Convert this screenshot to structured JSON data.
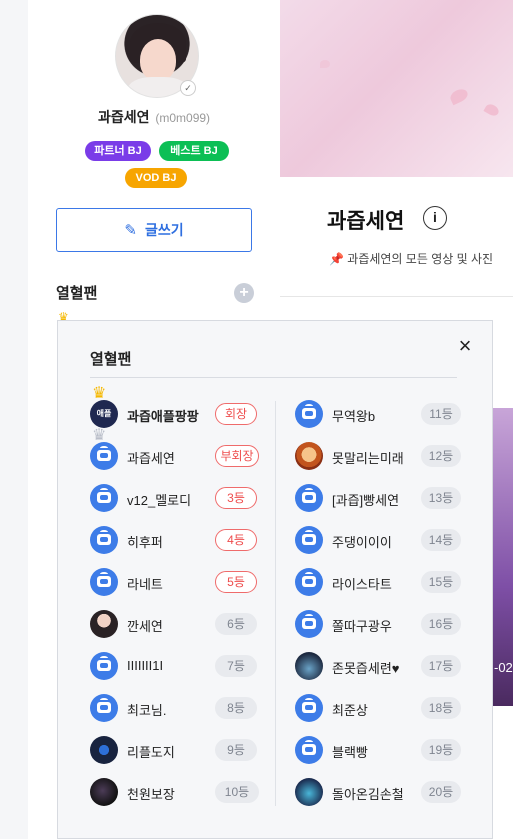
{
  "profile": {
    "name": "과즙세연",
    "uid": "(m0m099)",
    "badges": [
      "파트너 BJ",
      "베스트 BJ",
      "VOD BJ"
    ],
    "write_label": "글쓰기",
    "fan_heading": "열혈팬",
    "fan_plus": "+"
  },
  "main": {
    "title": "과즙세연",
    "desc": "📌 과즙세연의 모든 영상 및 사진",
    "thumb_text": "-02"
  },
  "popup": {
    "title": "열혈팬",
    "close": "×",
    "left": [
      {
        "name": "과즙애플팡팡",
        "rank": "회장",
        "style": "red",
        "avatar": "apple",
        "crown": "gold",
        "bold": true
      },
      {
        "name": "과즙세연",
        "rank": "부회장",
        "style": "red",
        "avatar": "tv",
        "crown": "silver",
        "bold": false
      },
      {
        "name": "v12_멜로디",
        "rank": "3등",
        "style": "red",
        "avatar": "tv",
        "crown": "",
        "bold": false
      },
      {
        "name": "히후퍼",
        "rank": "4등",
        "style": "red",
        "avatar": "tv",
        "crown": "",
        "bold": false
      },
      {
        "name": "라네트",
        "rank": "5등",
        "style": "red",
        "avatar": "tv",
        "crown": "",
        "bold": false
      },
      {
        "name": "깐세연",
        "rank": "6등",
        "style": "gray",
        "avatar": "photo1",
        "crown": "",
        "bold": false
      },
      {
        "name": "IIIIIII1I",
        "rank": "7등",
        "style": "gray",
        "avatar": "tv",
        "crown": "",
        "bold": false
      },
      {
        "name": "최코님.",
        "rank": "8등",
        "style": "gray",
        "avatar": "tv",
        "crown": "",
        "bold": false
      },
      {
        "name": "리플도지",
        "rank": "9등",
        "style": "gray",
        "avatar": "tech",
        "crown": "",
        "bold": false
      },
      {
        "name": "천원보장",
        "rank": "10등",
        "style": "gray",
        "avatar": "dark1",
        "crown": "",
        "bold": false
      }
    ],
    "right": [
      {
        "name": "무역왕b",
        "rank": "11등",
        "style": "gray",
        "avatar": "tv"
      },
      {
        "name": "못말리는미래",
        "rank": "12등",
        "style": "gray",
        "avatar": "orange"
      },
      {
        "name": "[과즙]빵세연",
        "rank": "13등",
        "style": "gray",
        "avatar": "tv"
      },
      {
        "name": "주댕이이이",
        "rank": "14등",
        "style": "gray",
        "avatar": "tv"
      },
      {
        "name": "라이스타트",
        "rank": "15등",
        "style": "gray",
        "avatar": "tv"
      },
      {
        "name": "쫄따구광우",
        "rank": "16등",
        "style": "gray",
        "avatar": "tv"
      },
      {
        "name": "존못즙세련♥",
        "rank": "17등",
        "style": "gray",
        "avatar": "night"
      },
      {
        "name": "최준상",
        "rank": "18등",
        "style": "gray",
        "avatar": "tv"
      },
      {
        "name": "블랙빵",
        "rank": "19등",
        "style": "gray",
        "avatar": "tv"
      },
      {
        "name": "돌아온김손철",
        "rank": "20등",
        "style": "gray",
        "avatar": "game"
      }
    ],
    "apple_text": "애플"
  },
  "colors": {
    "accent_blue": "#3b78e7",
    "rank_red": "#ee4d4d",
    "partner_purple": "#7a3ce8",
    "best_green": "#0cbf55",
    "vod_orange": "#f7a500"
  },
  "icons": {
    "write": "pencil-icon",
    "close": "close-icon",
    "info": "info-icon",
    "add": "plus-icon",
    "crown": "crown-icon",
    "default_avatar": "tv-icon"
  }
}
